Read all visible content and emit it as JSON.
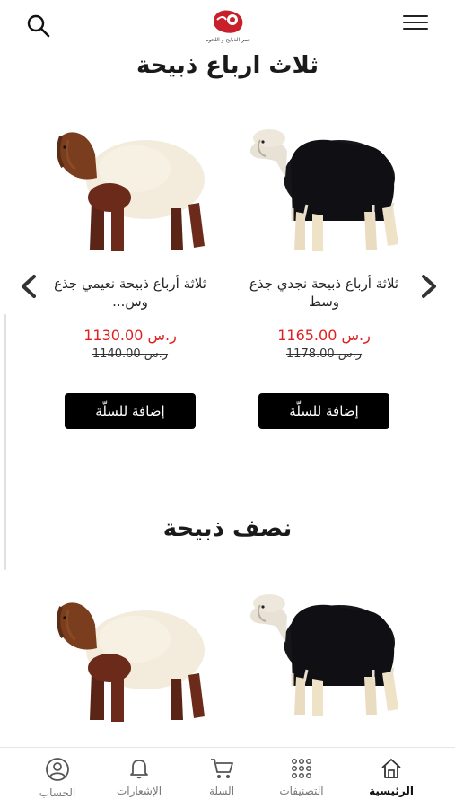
{
  "header": {
    "logo_caption": "عمر الذبايح و اللحوم",
    "search_icon": "search-icon",
    "menu_icon": "hamburger-menu-icon"
  },
  "sections": [
    {
      "title": "ثلاث ارباع ذبيحة",
      "products": [
        {
          "name": "ثلاثة أرباع ذبيحة نجدي جذع وسط",
          "price": "1165.00 ر.س",
          "old_price": "1178.00 ر.س",
          "button": "إضافة للسلّة"
        },
        {
          "name": "ثلاثة أرباع ذبيحة نعيمي جذع وس...",
          "price": "1130.00 ر.س",
          "old_price": "1140.00 ر.س",
          "button": "إضافة للسلّة"
        }
      ]
    },
    {
      "title": "نصف ذبيحة",
      "products": []
    }
  ],
  "nav": [
    {
      "label": "الرئيسية",
      "icon": "home-icon",
      "active": true
    },
    {
      "label": "التصنيفات",
      "icon": "grid-icon",
      "active": false
    },
    {
      "label": "السلة",
      "icon": "cart-icon",
      "active": false
    },
    {
      "label": "الإشعارات",
      "icon": "bell-icon",
      "active": false
    },
    {
      "label": "الحساب",
      "icon": "user-icon",
      "active": false
    }
  ],
  "colors": {
    "price": "#e02020",
    "button_bg": "#000000",
    "logo_red": "#c8202a"
  }
}
